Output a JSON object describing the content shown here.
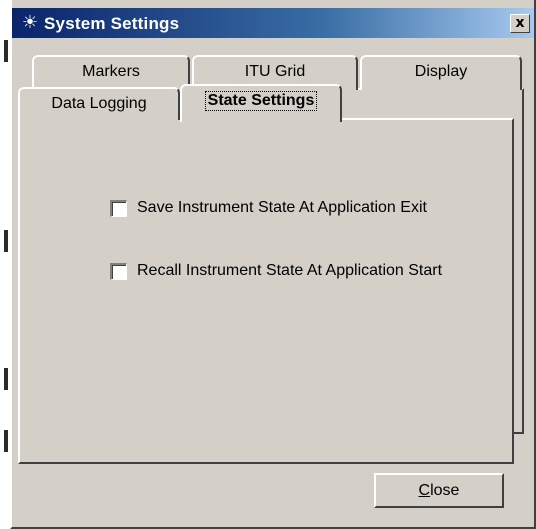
{
  "window": {
    "title": "System Settings",
    "title_icon": "sparkle-icon",
    "close_glyph": "x"
  },
  "tabs": {
    "back_row": [
      {
        "label": "Markers"
      },
      {
        "label": "ITU Grid"
      },
      {
        "label": "Display"
      }
    ],
    "front_row": [
      {
        "label": "Data Logging"
      },
      {
        "label": "State Settings",
        "active": true
      }
    ]
  },
  "state_settings": {
    "options": [
      {
        "label": "Save Instrument State At Application Exit",
        "checked": false
      },
      {
        "label": "Recall Instrument State At Application Start",
        "checked": false
      }
    ]
  },
  "footer": {
    "close_access_key": "C",
    "close_rest": "lose"
  },
  "colors": {
    "face": "#d4d0c8",
    "title_start": "#0a246a",
    "title_end": "#a6caf0"
  }
}
